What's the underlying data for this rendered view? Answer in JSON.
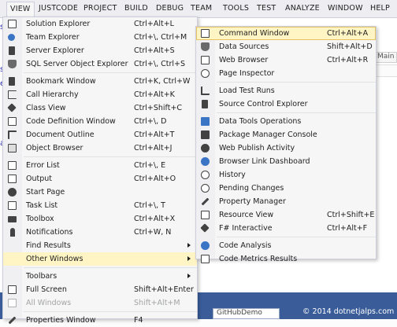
{
  "menubar": {
    "items": [
      "VIEW",
      "JUSTCODE",
      "PROJECT",
      "BUILD",
      "DEBUG",
      "TEAM",
      "TOOLS",
      "TEST",
      "ANALYZE",
      "WINDOW",
      "HELP"
    ]
  },
  "background": {
    "tab_label": "Main",
    "bottom_doc_label": "GitHubDemo",
    "copyright": "© 2014 dotnetjalps.com"
  },
  "view_menu": {
    "items": [
      {
        "label": "Solution Explorer",
        "shortcut": "Ctrl+Alt+L",
        "icon": "solution-explorer-icon"
      },
      {
        "label": "Team Explorer",
        "shortcut": "Ctrl+\\, Ctrl+M",
        "icon": "team-explorer-icon"
      },
      {
        "label": "Server Explorer",
        "shortcut": "Ctrl+Alt+S",
        "icon": "server-explorer-icon"
      },
      {
        "label": "SQL Server Object Explorer",
        "shortcut": "Ctrl+\\, Ctrl+S",
        "icon": "sql-server-icon"
      },
      {
        "label": "Bookmark Window",
        "shortcut": "Ctrl+K, Ctrl+W",
        "icon": "bookmark-icon"
      },
      {
        "label": "Call Hierarchy",
        "shortcut": "Ctrl+Alt+K",
        "icon": "call-hierarchy-icon"
      },
      {
        "label": "Class View",
        "shortcut": "Ctrl+Shift+C",
        "icon": "class-view-icon"
      },
      {
        "label": "Code Definition Window",
        "shortcut": "Ctrl+\\, D",
        "icon": "code-definition-icon"
      },
      {
        "label": "Document Outline",
        "shortcut": "Ctrl+Alt+T",
        "icon": "document-outline-icon"
      },
      {
        "label": "Object Browser",
        "shortcut": "Ctrl+Alt+J",
        "icon": "object-browser-icon"
      },
      {
        "label": "Error List",
        "shortcut": "Ctrl+\\, E",
        "icon": "error-list-icon"
      },
      {
        "label": "Output",
        "shortcut": "Ctrl+Alt+O",
        "icon": "output-icon"
      },
      {
        "label": "Start Page",
        "shortcut": "",
        "icon": "start-page-icon"
      },
      {
        "label": "Task List",
        "shortcut": "Ctrl+\\, T",
        "icon": "task-list-icon"
      },
      {
        "label": "Toolbox",
        "shortcut": "Ctrl+Alt+X",
        "icon": "toolbox-icon"
      },
      {
        "label": "Notifications",
        "shortcut": "Ctrl+W, N",
        "icon": "notifications-icon"
      },
      {
        "label": "Find Results",
        "shortcut": "",
        "icon": ""
      },
      {
        "label": "Other Windows",
        "shortcut": "",
        "icon": ""
      },
      {
        "label": "Toolbars",
        "shortcut": "",
        "icon": ""
      },
      {
        "label": "Full Screen",
        "shortcut": "Shift+Alt+Enter",
        "icon": "full-screen-icon"
      },
      {
        "label": "All Windows",
        "shortcut": "Shift+Alt+M",
        "icon": "all-windows-icon"
      },
      {
        "label": "Properties Window",
        "shortcut": "F4",
        "icon": "properties-icon"
      }
    ]
  },
  "other_windows_menu": {
    "items": [
      {
        "label": "Command Window",
        "shortcut": "Ctrl+Alt+A",
        "icon": "command-window-icon"
      },
      {
        "label": "Data Sources",
        "shortcut": "Shift+Alt+D",
        "icon": "data-sources-icon"
      },
      {
        "label": "Web Browser",
        "shortcut": "Ctrl+Alt+R",
        "icon": "web-browser-icon"
      },
      {
        "label": "Page Inspector",
        "shortcut": "",
        "icon": "page-inspector-icon"
      },
      {
        "label": "Load Test Runs",
        "shortcut": "",
        "icon": "load-test-icon"
      },
      {
        "label": "Source Control Explorer",
        "shortcut": "",
        "icon": "source-control-icon"
      },
      {
        "label": "Data Tools Operations",
        "shortcut": "",
        "icon": "data-tools-icon"
      },
      {
        "label": "Package Manager Console",
        "shortcut": "",
        "icon": "package-manager-icon"
      },
      {
        "label": "Web Publish Activity",
        "shortcut": "",
        "icon": "web-publish-icon"
      },
      {
        "label": "Browser Link Dashboard",
        "shortcut": "",
        "icon": "browser-link-icon"
      },
      {
        "label": "History",
        "shortcut": "",
        "icon": "history-icon"
      },
      {
        "label": "Pending Changes",
        "shortcut": "",
        "icon": "pending-changes-icon"
      },
      {
        "label": "Property Manager",
        "shortcut": "",
        "icon": "property-manager-icon"
      },
      {
        "label": "Resource View",
        "shortcut": "Ctrl+Shift+E",
        "icon": "resource-view-icon"
      },
      {
        "label": "F# Interactive",
        "shortcut": "Ctrl+Alt+F",
        "icon": "fsharp-icon"
      },
      {
        "label": "Code Analysis",
        "shortcut": "",
        "icon": "code-analysis-icon"
      },
      {
        "label": "Code Metrics Results",
        "shortcut": "",
        "icon": "code-metrics-icon"
      }
    ]
  },
  "colors": {
    "highlight": "#fff5c4",
    "menu_bg": "#f6f6f6",
    "icon_blue": "#3a74c5",
    "icon_dark": "#424242"
  }
}
